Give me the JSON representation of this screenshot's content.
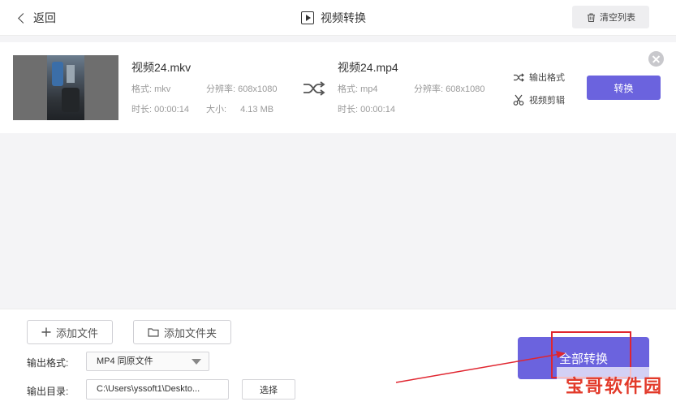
{
  "header": {
    "back_label": "返回",
    "title": "视频转换",
    "clear_label": "清空列表"
  },
  "file": {
    "source": {
      "name": "视频24.mkv",
      "format_label": "格式: mkv",
      "resolution_label": "分辨率: 608x1080",
      "duration_label": "时长: 00:00:14",
      "size_label": "大小:",
      "size_value": "4.13 MB"
    },
    "output": {
      "name": "视频24.mp4",
      "format_label": "格式: mp4",
      "resolution_label": "分辨率: 608x1080",
      "duration_label": "时长: 00:00:14"
    },
    "output_format_label": "输出格式",
    "video_edit_label": "视频剪辑",
    "convert_label": "转换"
  },
  "footer": {
    "add_file_label": "添加文件",
    "add_folder_label": "添加文件夹",
    "output_format_field_label": "输出格式:",
    "output_format_value": "MP4 同原文件",
    "output_dir_label": "输出目录:",
    "output_dir_value": "C:\\Users\\yssoft1\\Deskto...",
    "choose_label": "选择",
    "convert_all_label": "全部转换"
  },
  "watermark": "宝哥软件园",
  "colors": {
    "accent": "#6b63de",
    "highlight": "#e0252f"
  }
}
